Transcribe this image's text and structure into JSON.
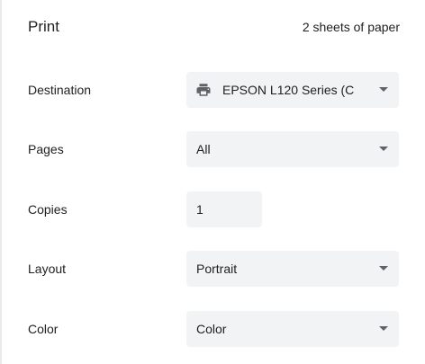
{
  "header": {
    "title": "Print",
    "sheets": "2 sheets of paper"
  },
  "destination": {
    "label": "Destination",
    "value": "EPSON L120 Series (C",
    "icon": "printer-icon"
  },
  "pages": {
    "label": "Pages",
    "value": "All"
  },
  "copies": {
    "label": "Copies",
    "value": "1"
  },
  "layout": {
    "label": "Layout",
    "value": "Portrait"
  },
  "color": {
    "label": "Color",
    "value": "Color"
  },
  "colors": {
    "control_bg": "#f1f3f4",
    "text": "#202124",
    "icon": "#5f6368"
  }
}
